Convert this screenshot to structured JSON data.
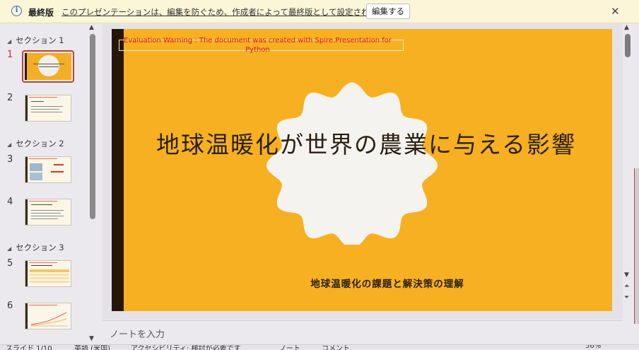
{
  "infobar": {
    "icon": "info-icon",
    "title": "最終版",
    "message": "このプレゼンテーションは、編集を防ぐため、作成者によって最終版として設定されています。",
    "edit_button": "編集する",
    "close": "✕"
  },
  "thumbnails": {
    "sections": [
      {
        "label": "セクション 1"
      },
      {
        "label": "セクション 2"
      },
      {
        "label": "セクション 3"
      }
    ],
    "slides": [
      {
        "number": "1"
      },
      {
        "number": "2"
      },
      {
        "number": "3"
      },
      {
        "number": "4"
      },
      {
        "number": "5"
      },
      {
        "number": "6"
      }
    ],
    "selected": 1
  },
  "slide": {
    "warning": "Evaluation Warning : The document was created with Spire.Presentation for Python",
    "title": "地球温暖化が世界の農業に与える影響",
    "subtitle": "地球温暖化の課題と解決策の理解",
    "colors": {
      "background": "#f6b022",
      "left_bar": "#251708",
      "blob": "#f5f3f0",
      "text": "#2a1f12",
      "warning": "#e0101a"
    }
  },
  "notes": {
    "placeholder": "ノートを入力"
  },
  "statusbar": {
    "slide_info": "スライド 1/10",
    "language": "英語 (米国)",
    "accessibility": "アクセシビリティ: 検討が必要です",
    "notes_label": "ノート",
    "comments_label": "コメント",
    "zoom": "56%"
  }
}
